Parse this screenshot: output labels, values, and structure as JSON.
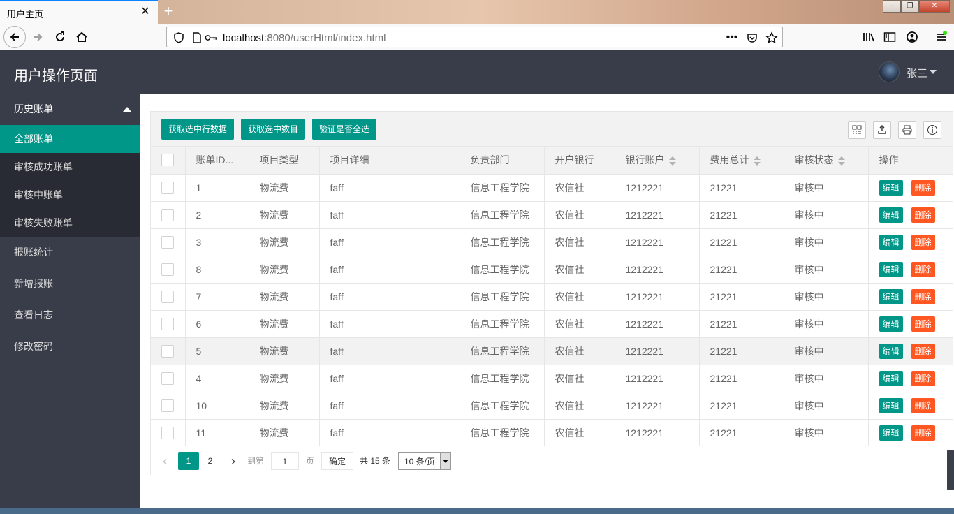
{
  "browser": {
    "tab_title": "用户主页",
    "tab_close": "✕",
    "new_tab": "+",
    "url_host": "localhost",
    "url_rest": ":8080/userHtml/index.html",
    "window_buttons": [
      "–",
      "❐",
      "✕"
    ]
  },
  "header": {
    "title": "用户操作页面",
    "username": "张三"
  },
  "sidebar": {
    "group_label": "历史账单",
    "sub_items": [
      {
        "label": "全部账单",
        "active": true
      },
      {
        "label": "审核成功账单",
        "active": false
      },
      {
        "label": "审核中账单",
        "active": false
      },
      {
        "label": "审核失败账单",
        "active": false
      }
    ],
    "items": [
      {
        "label": "报账统计"
      },
      {
        "label": "新增报账"
      },
      {
        "label": "查看日志"
      },
      {
        "label": "修改密码"
      }
    ]
  },
  "toolbar": {
    "buttons": [
      "获取选中行数据",
      "获取选中数目",
      "验证是否全选"
    ],
    "icons": [
      "columns-icon",
      "export-icon",
      "print-icon",
      "info-icon"
    ]
  },
  "table": {
    "columns": [
      "账单ID...",
      "项目类型",
      "项目详细",
      "负责部门",
      "开户银行",
      "银行账户",
      "费用总计",
      "审核状态",
      "操作"
    ],
    "sortable": [
      false,
      false,
      false,
      false,
      false,
      true,
      true,
      true,
      false
    ],
    "rows": [
      {
        "id": "1",
        "type": "物流费",
        "detail": "faff",
        "dept": "信息工程学院",
        "bank": "农信社",
        "account": "1212221",
        "total": "21221",
        "status": "审核中"
      },
      {
        "id": "2",
        "type": "物流费",
        "detail": "faff",
        "dept": "信息工程学院",
        "bank": "农信社",
        "account": "1212221",
        "total": "21221",
        "status": "审核中"
      },
      {
        "id": "3",
        "type": "物流费",
        "detail": "faff",
        "dept": "信息工程学院",
        "bank": "农信社",
        "account": "1212221",
        "total": "21221",
        "status": "审核中"
      },
      {
        "id": "8",
        "type": "物流费",
        "detail": "faff",
        "dept": "信息工程学院",
        "bank": "农信社",
        "account": "1212221",
        "total": "21221",
        "status": "审核中"
      },
      {
        "id": "7",
        "type": "物流费",
        "detail": "faff",
        "dept": "信息工程学院",
        "bank": "农信社",
        "account": "1212221",
        "total": "21221",
        "status": "审核中"
      },
      {
        "id": "6",
        "type": "物流费",
        "detail": "faff",
        "dept": "信息工程学院",
        "bank": "农信社",
        "account": "1212221",
        "total": "21221",
        "status": "审核中"
      },
      {
        "id": "5",
        "type": "物流费",
        "detail": "faff",
        "dept": "信息工程学院",
        "bank": "农信社",
        "account": "1212221",
        "total": "21221",
        "status": "审核中"
      },
      {
        "id": "4",
        "type": "物流费",
        "detail": "faff",
        "dept": "信息工程学院",
        "bank": "农信社",
        "account": "1212221",
        "total": "21221",
        "status": "审核中"
      },
      {
        "id": "10",
        "type": "物流费",
        "detail": "faff",
        "dept": "信息工程学院",
        "bank": "农信社",
        "account": "1212221",
        "total": "21221",
        "status": "审核中"
      },
      {
        "id": "11",
        "type": "物流费",
        "detail": "faff",
        "dept": "信息工程学院",
        "bank": "农信社",
        "account": "1212221",
        "total": "21221",
        "status": "审核中"
      }
    ],
    "hover_row_index": 6,
    "edit_label": "编辑",
    "delete_label": "删除"
  },
  "pager": {
    "prev": "‹",
    "pages": [
      "1",
      "2"
    ],
    "current": "1",
    "next": "›",
    "goto_prefix": "到第",
    "goto_value": "1",
    "goto_suffix": "页",
    "confirm": "确定",
    "total": "共 15 条",
    "page_size": "10 条/页"
  },
  "colors": {
    "accent": "#009688",
    "danger": "#ff5722",
    "header_bg": "#393d49",
    "submenu_bg": "#282b33"
  }
}
